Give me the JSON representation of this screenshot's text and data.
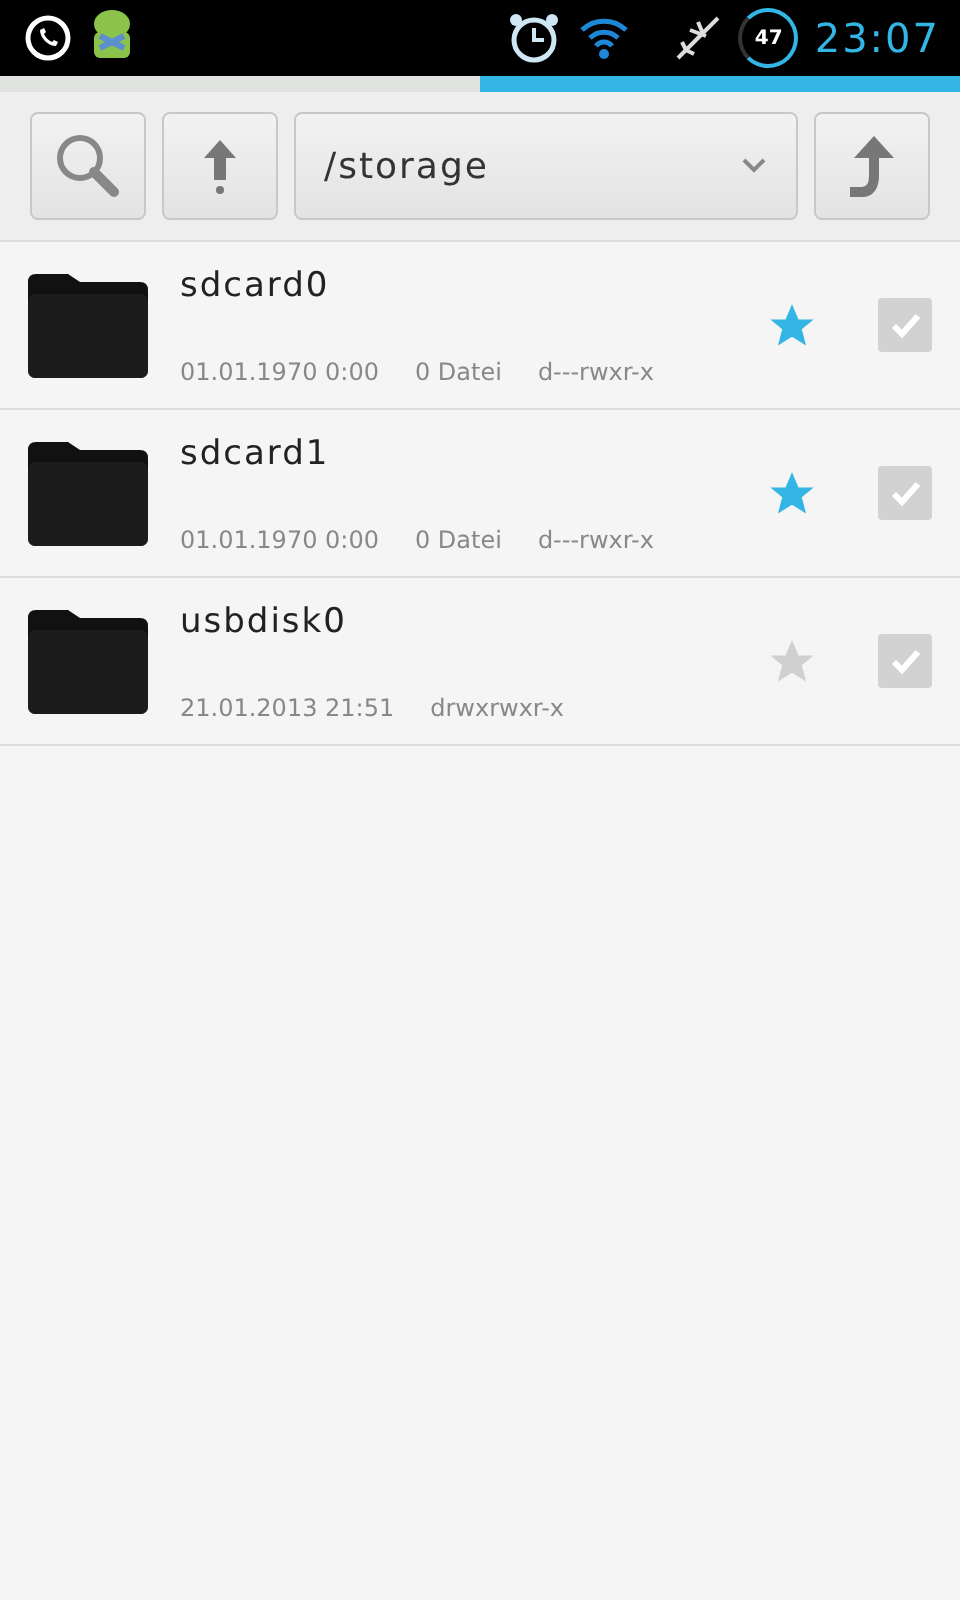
{
  "status_bar": {
    "battery": "47",
    "time": "23:07"
  },
  "storage_meter": {
    "level": 0.5
  },
  "toolbar": {
    "path": "/storage"
  },
  "files": [
    {
      "name": "sdcard0",
      "date": "01.01.1970 0:00",
      "count": "0 Datei",
      "permissions": "d---rwxr-x",
      "favorite": true,
      "checked": false
    },
    {
      "name": "sdcard1",
      "date": "01.01.1970 0:00",
      "count": "0 Datei",
      "permissions": "d---rwxr-x",
      "favorite": true,
      "checked": false
    },
    {
      "name": "usbdisk0",
      "date": "21.01.2013 21:51",
      "permissions": "drwxrwxr-x",
      "favorite": false,
      "checked": false
    }
  ]
}
